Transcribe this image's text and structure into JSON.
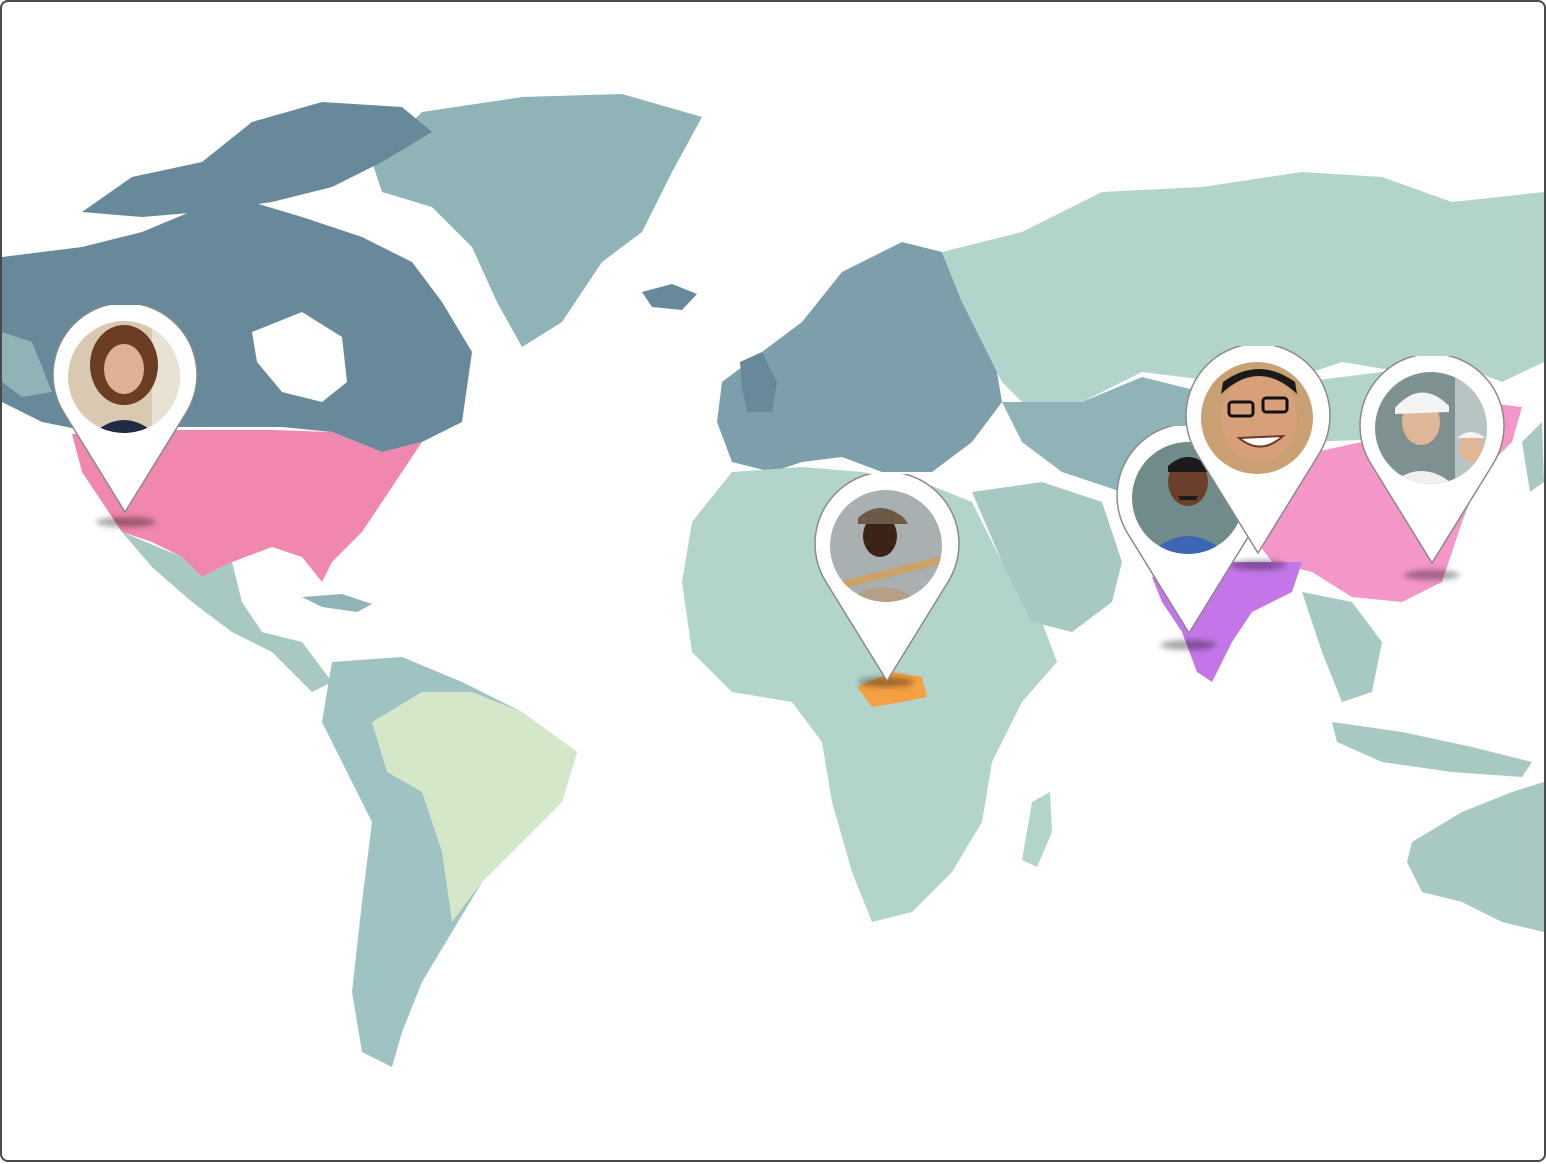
{
  "map": {
    "colors": {
      "background": "#ffffff",
      "land_dark": "#67899a",
      "land_mid": "#8fb3b6",
      "land_light": "#b3d4cb",
      "land_pale": "#d4e7c8",
      "highlight_usa": "#f087ae",
      "highlight_china": "#f497c8",
      "highlight_india": "#c476e8",
      "highlight_central_africa": "#f5a042"
    },
    "highlighted_regions": [
      {
        "name": "united-states",
        "color": "#f087ae"
      },
      {
        "name": "central-african-republic",
        "color": "#f5a042"
      },
      {
        "name": "india",
        "color": "#c476e8"
      },
      {
        "name": "china",
        "color": "#f497c8"
      }
    ],
    "pins": [
      {
        "id": "usa",
        "icon": "woman-portrait",
        "location": "united-states"
      },
      {
        "id": "africa",
        "icon": "man-with-cap-portrait",
        "location": "central-african-republic"
      },
      {
        "id": "india",
        "icon": "man-with-mustache-portrait",
        "location": "india"
      },
      {
        "id": "china-1",
        "icon": "man-with-glasses-portrait",
        "location": "china"
      },
      {
        "id": "china-2",
        "icon": "worker-with-cap-portrait",
        "location": "china"
      }
    ]
  }
}
